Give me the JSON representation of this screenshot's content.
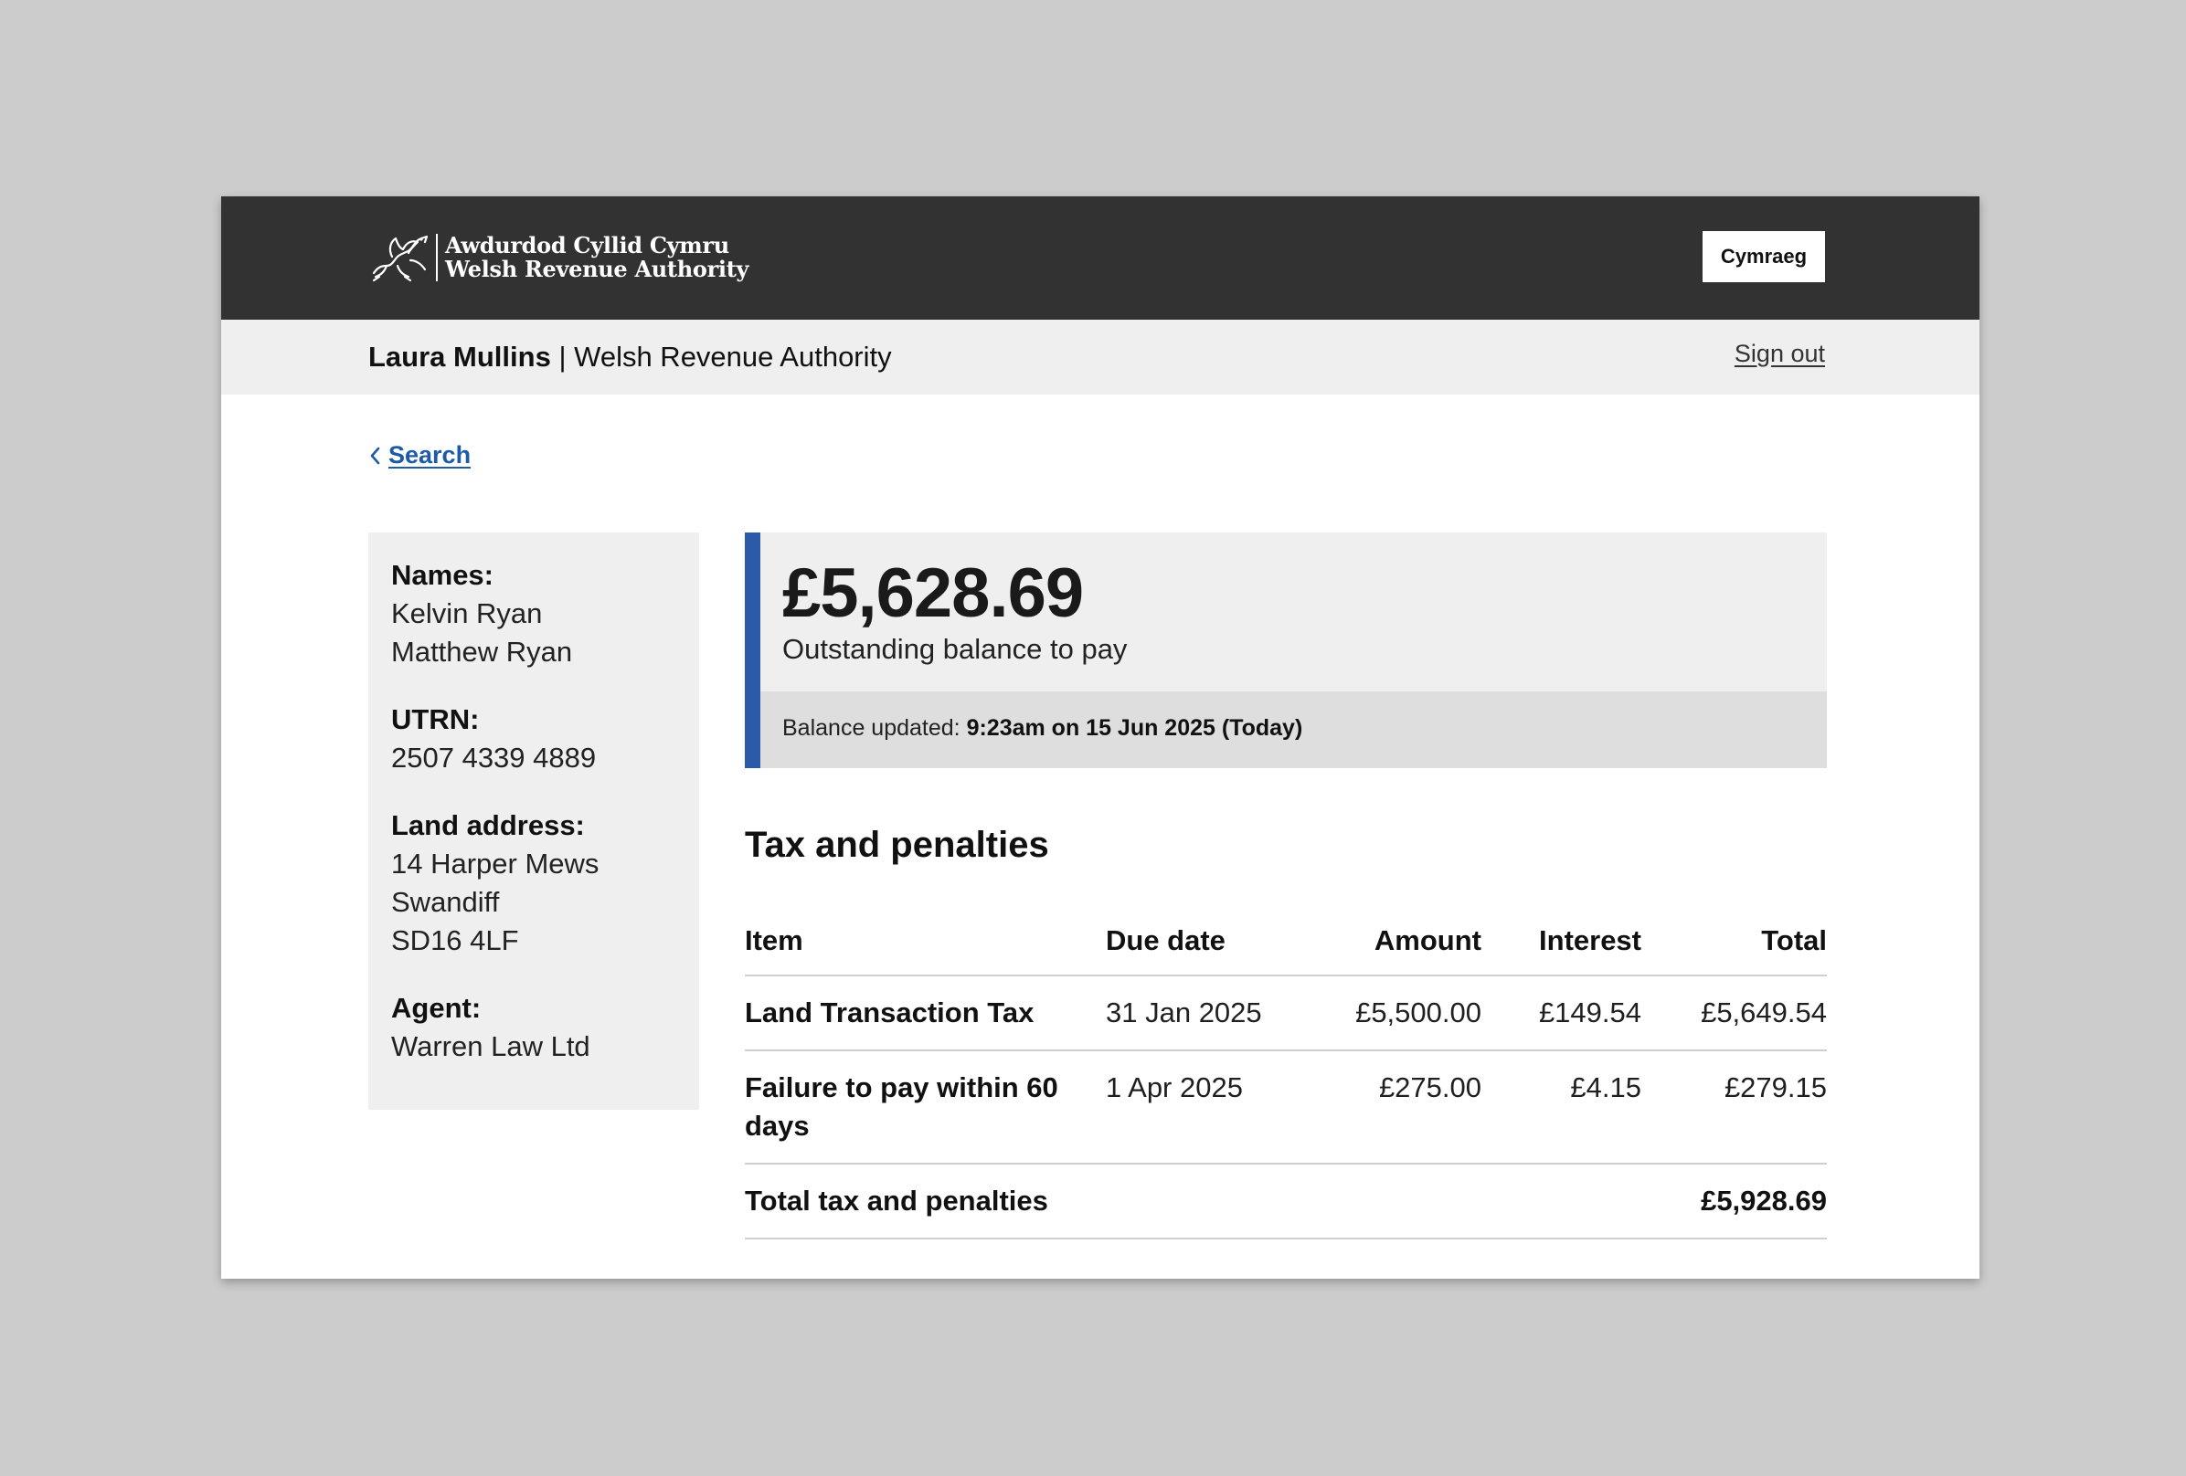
{
  "header": {
    "logo_line1": "Awdurdod Cyllid Cymru",
    "logo_line2": "Welsh Revenue Authority",
    "logo_icon": "welsh-dragon-icon",
    "language_button": "Cymraeg"
  },
  "user_bar": {
    "user_name": "Laura Mullins",
    "separator": "|",
    "organisation": "Welsh Revenue Authority",
    "sign_out": "Sign out"
  },
  "back_link": {
    "label": "Search",
    "icon": "chevron-left-icon"
  },
  "sidebar": {
    "names_label": "Names:",
    "names": [
      "Kelvin Ryan",
      "Matthew Ryan"
    ],
    "utrn_label": "UTRN:",
    "utrn": "2507 4339 4889",
    "address_label": "Land address:",
    "address": [
      "14 Harper Mews",
      "Swandiff",
      "SD16 4LF"
    ],
    "agent_label": "Agent:",
    "agent": "Warren Law Ltd"
  },
  "balance": {
    "amount": "£5,628.69",
    "caption": "Outstanding balance to pay",
    "updated_label": "Balance updated:",
    "updated_value": "9:23am on 15 Jun 2025 (Today)",
    "accent_color": "#2b5ba8"
  },
  "tax_section": {
    "title": "Tax and penalties",
    "columns": {
      "item": "Item",
      "due_date": "Due date",
      "amount": "Amount",
      "interest": "Interest",
      "total": "Total"
    },
    "rows": [
      {
        "item": "Land Transaction Tax",
        "due_date": "31 Jan 2025",
        "amount": "£5,500.00",
        "interest": "£149.54",
        "total": "£5,649.54"
      },
      {
        "item": "Failure to pay within 60 days",
        "due_date": "1 Apr 2025",
        "amount": "£275.00",
        "interest": "£4.15",
        "total": "£279.15"
      }
    ],
    "total_label": "Total tax and penalties",
    "total_value": "£5,928.69"
  }
}
